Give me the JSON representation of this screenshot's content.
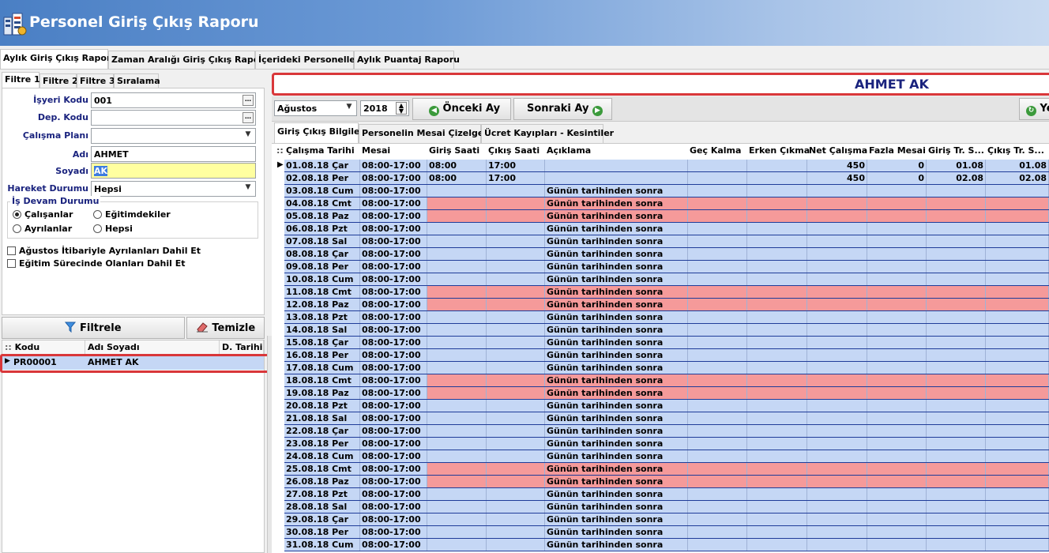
{
  "window": {
    "title": "Personel Giriş Çıkış Raporu"
  },
  "top_tabs": [
    "Aylık Giriş Çıkış Raporu",
    "Zaman Aralığı Giriş Çıkış Raporu",
    "İçerideki Personeller",
    "Aylık Puantaj Raporu"
  ],
  "filter_tabs": [
    "Filtre 1",
    "Filtre 2",
    "Filtre 3",
    "Sıralama"
  ],
  "filter": {
    "isyeri_kodu": {
      "label": "İşyeri Kodu",
      "value": "001"
    },
    "dep_kodu": {
      "label": "Dep. Kodu",
      "value": ""
    },
    "calisma_plani": {
      "label": "Çalışma Planı",
      "value": ""
    },
    "adi": {
      "label": "Adı",
      "value": "AHMET"
    },
    "soyadi": {
      "label": "Soyadı",
      "value": "AK"
    },
    "hareket_durumu": {
      "label": "Hareket Durumu",
      "value": "Hepsi"
    },
    "is_devam": {
      "title": "İş Devam Durumu",
      "options": [
        "Çalışanlar",
        "Eğitimdekiler",
        "Ayrılanlar",
        "Hepsi"
      ],
      "selected": "Çalışanlar"
    },
    "checks": [
      "Ağustos İtibariyle Ayrılanları Dahil Et",
      "Eğitim Sürecinde Olanları Dahil Et"
    ]
  },
  "buttons": {
    "filtrele": "Filtrele",
    "temizle": "Temizle"
  },
  "left_grid": {
    "headers": [
      "Kodu",
      "Adı Soyadı",
      "D. Tarihi"
    ],
    "rows": [
      {
        "kodu": "PR00001",
        "adi": "AHMET AK",
        "d_tarihi": ""
      }
    ]
  },
  "selected_person": "AHMET AK",
  "toolbar": {
    "month": "Ağustos",
    "year": "2018",
    "prev": "Önceki Ay",
    "next": "Sonraki Ay",
    "refresh": "Yenile"
  },
  "inner_tabs": [
    "Giriş Çıkış Bilgileri",
    "Personelin Mesai Çizelgesi",
    "Ücret Kayıpları - Kesintiler"
  ],
  "main_grid": {
    "headers": [
      "Çalışma Tarihi",
      "Mesai",
      "Giriş Saati",
      "Çıkış Saati",
      "Açıklama",
      "Geç Kalma",
      "Erken Çıkma",
      "Net Çalışma",
      "Fazla Mesai",
      "Giriş Tr. S...",
      "Çıkış Tr. S..."
    ],
    "rows": [
      [
        "01.08.18 Çar",
        "08:00-17:00",
        "08:00",
        "17:00",
        "",
        "",
        "",
        "450",
        "0",
        "01.08",
        "01.08"
      ],
      [
        "02.08.18 Per",
        "08:00-17:00",
        "08:00",
        "17:00",
        "",
        "",
        "",
        "450",
        "0",
        "02.08",
        "02.08"
      ],
      [
        "03.08.18 Cum",
        "08:00-17:00",
        "",
        "",
        "Günün tarihinden sonra",
        "",
        "",
        "",
        "",
        "",
        ""
      ],
      [
        "04.08.18 Cmt",
        "08:00-17:00",
        "",
        "",
        "Günün tarihinden sonra",
        "",
        "",
        "",
        "",
        "",
        ""
      ],
      [
        "05.08.18 Paz",
        "08:00-17:00",
        "",
        "",
        "Günün tarihinden sonra",
        "",
        "",
        "",
        "",
        "",
        ""
      ],
      [
        "06.08.18 Pzt",
        "08:00-17:00",
        "",
        "",
        "Günün tarihinden sonra",
        "",
        "",
        "",
        "",
        "",
        ""
      ],
      [
        "07.08.18 Sal",
        "08:00-17:00",
        "",
        "",
        "Günün tarihinden sonra",
        "",
        "",
        "",
        "",
        "",
        ""
      ],
      [
        "08.08.18 Çar",
        "08:00-17:00",
        "",
        "",
        "Günün tarihinden sonra",
        "",
        "",
        "",
        "",
        "",
        ""
      ],
      [
        "09.08.18 Per",
        "08:00-17:00",
        "",
        "",
        "Günün tarihinden sonra",
        "",
        "",
        "",
        "",
        "",
        ""
      ],
      [
        "10.08.18 Cum",
        "08:00-17:00",
        "",
        "",
        "Günün tarihinden sonra",
        "",
        "",
        "",
        "",
        "",
        ""
      ],
      [
        "11.08.18 Cmt",
        "08:00-17:00",
        "",
        "",
        "Günün tarihinden sonra",
        "",
        "",
        "",
        "",
        "",
        ""
      ],
      [
        "12.08.18 Paz",
        "08:00-17:00",
        "",
        "",
        "Günün tarihinden sonra",
        "",
        "",
        "",
        "",
        "",
        ""
      ],
      [
        "13.08.18 Pzt",
        "08:00-17:00",
        "",
        "",
        "Günün tarihinden sonra",
        "",
        "",
        "",
        "",
        "",
        ""
      ],
      [
        "14.08.18 Sal",
        "08:00-17:00",
        "",
        "",
        "Günün tarihinden sonra",
        "",
        "",
        "",
        "",
        "",
        ""
      ],
      [
        "15.08.18 Çar",
        "08:00-17:00",
        "",
        "",
        "Günün tarihinden sonra",
        "",
        "",
        "",
        "",
        "",
        ""
      ],
      [
        "16.08.18 Per",
        "08:00-17:00",
        "",
        "",
        "Günün tarihinden sonra",
        "",
        "",
        "",
        "",
        "",
        ""
      ],
      [
        "17.08.18 Cum",
        "08:00-17:00",
        "",
        "",
        "Günün tarihinden sonra",
        "",
        "",
        "",
        "",
        "",
        ""
      ],
      [
        "18.08.18 Cmt",
        "08:00-17:00",
        "",
        "",
        "Günün tarihinden sonra",
        "",
        "",
        "",
        "",
        "",
        ""
      ],
      [
        "19.08.18 Paz",
        "08:00-17:00",
        "",
        "",
        "Günün tarihinden sonra",
        "",
        "",
        "",
        "",
        "",
        ""
      ],
      [
        "20.08.18 Pzt",
        "08:00-17:00",
        "",
        "",
        "Günün tarihinden sonra",
        "",
        "",
        "",
        "",
        "",
        ""
      ],
      [
        "21.08.18 Sal",
        "08:00-17:00",
        "",
        "",
        "Günün tarihinden sonra",
        "",
        "",
        "",
        "",
        "",
        ""
      ],
      [
        "22.08.18 Çar",
        "08:00-17:00",
        "",
        "",
        "Günün tarihinden sonra",
        "",
        "",
        "",
        "",
        "",
        ""
      ],
      [
        "23.08.18 Per",
        "08:00-17:00",
        "",
        "",
        "Günün tarihinden sonra",
        "",
        "",
        "",
        "",
        "",
        ""
      ],
      [
        "24.08.18 Cum",
        "08:00-17:00",
        "",
        "",
        "Günün tarihinden sonra",
        "",
        "",
        "",
        "",
        "",
        ""
      ],
      [
        "25.08.18 Cmt",
        "08:00-17:00",
        "",
        "",
        "Günün tarihinden sonra",
        "",
        "",
        "",
        "",
        "",
        ""
      ],
      [
        "26.08.18 Paz",
        "08:00-17:00",
        "",
        "",
        "Günün tarihinden sonra",
        "",
        "",
        "",
        "",
        "",
        ""
      ],
      [
        "27.08.18 Pzt",
        "08:00-17:00",
        "",
        "",
        "Günün tarihinden sonra",
        "",
        "",
        "",
        "",
        "",
        ""
      ],
      [
        "28.08.18 Sal",
        "08:00-17:00",
        "",
        "",
        "Günün tarihinden sonra",
        "",
        "",
        "",
        "",
        "",
        ""
      ],
      [
        "29.08.18 Çar",
        "08:00-17:00",
        "",
        "",
        "Günün tarihinden sonra",
        "",
        "",
        "",
        "",
        "",
        ""
      ],
      [
        "30.08.18 Per",
        "08:00-17:00",
        "",
        "",
        "Günün tarihinden sonra",
        "",
        "",
        "",
        "",
        "",
        ""
      ],
      [
        "31.08.18 Cum",
        "08:00-17:00",
        "",
        "",
        "Günün tarihinden sonra",
        "",
        "",
        "",
        "",
        "",
        ""
      ]
    ]
  },
  "colors": {
    "weekend": "#f59a9a",
    "row": "#c5d7f5",
    "highlight": "#d9373a",
    "label": "#1a237e"
  }
}
